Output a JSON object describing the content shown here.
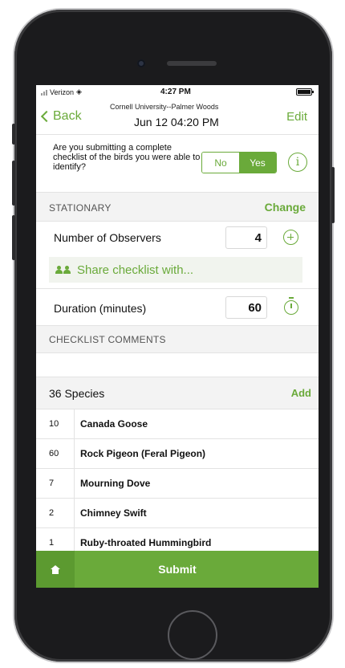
{
  "status_bar": {
    "carrier": "Verizon",
    "time": "4:27 PM"
  },
  "nav": {
    "back_label": "Back",
    "location": "Cornell University--Palmer Woods",
    "date_time": "Jun 12 04:20 PM",
    "edit_label": "Edit"
  },
  "complete_checklist": {
    "question": "Are you submitting a complete checklist of the birds you were able to identify?",
    "no_label": "No",
    "yes_label": "Yes",
    "selected": "Yes",
    "info_glyph": "i"
  },
  "protocol": {
    "label": "STATIONARY",
    "change_label": "Change"
  },
  "observers": {
    "label": "Number of Observers",
    "value": "4"
  },
  "share": {
    "label": "Share checklist with..."
  },
  "duration": {
    "label": "Duration (minutes)",
    "value": "60"
  },
  "comments": {
    "label": "CHECKLIST COMMENTS"
  },
  "species_header": {
    "count_label": "36 Species",
    "add_label": "Add"
  },
  "species": [
    {
      "count": "10",
      "name": "Canada Goose"
    },
    {
      "count": "60",
      "name": "Rock Pigeon (Feral Pigeon)"
    },
    {
      "count": "7",
      "name": "Mourning Dove"
    },
    {
      "count": "2",
      "name": "Chimney Swift"
    },
    {
      "count": "1",
      "name": "Ruby-throated Hummingbird"
    }
  ],
  "bottom_bar": {
    "submit_label": "Submit"
  },
  "colors": {
    "accent": "#6aaa3a",
    "accent_dark": "#5c9a30",
    "section_gray": "#f3f3f3"
  },
  "icons": {
    "back": "chevron-left-icon",
    "info": "info-icon",
    "add_observer": "plus-circle-icon",
    "share": "people-icon",
    "timer": "stopwatch-icon",
    "home": "home-icon"
  }
}
